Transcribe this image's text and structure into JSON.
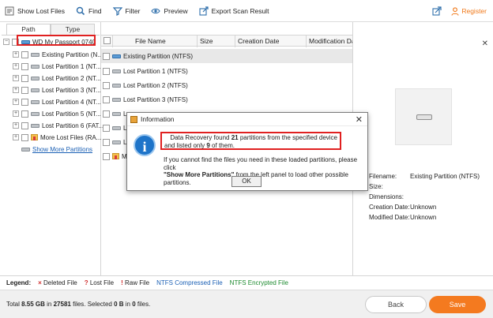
{
  "toolbar": {
    "show_lost_files": "Show Lost Files",
    "find": "Find",
    "filter": "Filter",
    "preview": "Preview",
    "export_scan_result": "Export Scan Result",
    "register": "Register"
  },
  "left_panel": {
    "tabs": [
      "Path",
      "Type"
    ],
    "root": "WD My Passport 0740",
    "items": [
      "Existing Partition (N...",
      "Lost Partition 1 (NT...",
      "Lost Partition 2 (NT...",
      "Lost Partition 3 (NT...",
      "Lost Partition 4 (NT...",
      "Lost Partition 5 (NT...",
      "Lost Partition 6 (FAT...",
      "More Lost Files (RA..."
    ],
    "show_more": "Show More Partitions"
  },
  "file_list": {
    "columns": [
      "File Name",
      "Size",
      "Creation Date",
      "Modification Dat"
    ],
    "rows": [
      "Existing Partition (NTFS)",
      "Lost Partition 1 (NTFS)",
      "Lost Partition 2 (NTFS)",
      "Lost Partition 3 (NTFS)",
      "L",
      "L",
      "L",
      "M"
    ]
  },
  "details": {
    "filename_label": "Filename:",
    "filename_value": "Existing Partition (NTFS)",
    "size_label": "Size:",
    "dimensions_label": "Dimensions:",
    "creation_label": "Creation Date:",
    "creation_value": "Unknown",
    "modified_label": "Modified Date:",
    "modified_value": "Unknown"
  },
  "legend": {
    "title": "Legend:",
    "deleted": "Deleted File",
    "lost": "Lost File",
    "raw": "Raw File",
    "ntfs_compressed": "NTFS Compressed File",
    "ntfs_encrypted": "NTFS Encrypted File"
  },
  "footer": {
    "total_prefix": "Total ",
    "total_size": "8.55 GB",
    "in": " in ",
    "total_files": "27581",
    "files_selected": " files.  Selected ",
    "selected_size": "0 B",
    "in2": " in ",
    "selected_files": "0",
    "files_end": " files.",
    "back": "Back",
    "save": "Save"
  },
  "dialog": {
    "title": "Information",
    "line1_a": "Data Recovery found ",
    "count_found": "21",
    "line1_b": " partitions from the specified device",
    "line2_a": "and listed only ",
    "count_listed": "9",
    "line2_b": " of them.",
    "line3": "If you cannot find the files you need in these loaded partitions, please click",
    "line4_bold": "\"Show More Partitions\"",
    "line4_rest": " from the left panel to load other possible partitions.",
    "ok": "OK"
  },
  "colors": {
    "accent": "#f47a1f",
    "highlight_border": "#e02020",
    "link": "#1a5fb4"
  }
}
